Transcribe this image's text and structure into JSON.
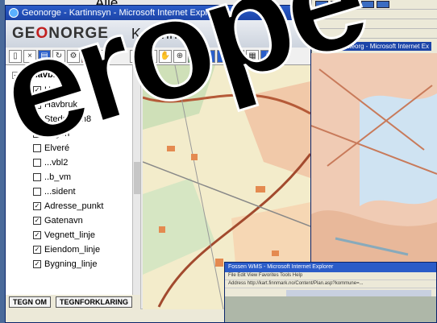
{
  "background": {
    "top_text": "Alle"
  },
  "window": {
    "title": "Geonorge - Kartinnsyn - Microsoft Internet Explorer",
    "brand_prefix": "GE",
    "brand_o": "O",
    "brand_suffix": "NORGE",
    "app_name": "Kartinnsyn"
  },
  "layers": {
    "root": "havbruk",
    "items": [
      {
        "label": "Havbruk",
        "checked": true
      },
      {
        "label": "Havbruk",
        "checked": true
      },
      {
        "label": "Stedsnavn8",
        "checked": true
      },
      {
        "label": "Vegen",
        "checked": false
      },
      {
        "label": "Elveré",
        "checked": false
      },
      {
        "label": "...vbl2",
        "checked": false
      },
      {
        "label": "..b_vm",
        "checked": false
      },
      {
        "label": "...sident",
        "checked": false
      },
      {
        "label": "Adresse_punkt",
        "checked": true
      },
      {
        "label": "Gatenavn",
        "checked": true
      },
      {
        "label": "Vegnett_linje",
        "checked": true
      },
      {
        "label": "Eiendom_linje",
        "checked": true
      },
      {
        "label": "Bygning_linje",
        "checked": true
      }
    ],
    "tabs": [
      "TEGN OM",
      "TEGNFORKLARING"
    ]
  },
  "win2": {
    "title": "...aregatteorg - Microsoft Internet Ex"
  },
  "win3": {
    "title": "Fossen WMS - Microsoft Internet Explorer",
    "menu": "File  Edit  View  Favorites  Tools  Help",
    "address": "Address  http://kart.finnmark.no/Content/Plan.asp?kommune=..."
  },
  "overlay_text": "erope",
  "colors": {
    "title_bar": "#2b5cc8",
    "brand_o": "#c21f1f"
  }
}
